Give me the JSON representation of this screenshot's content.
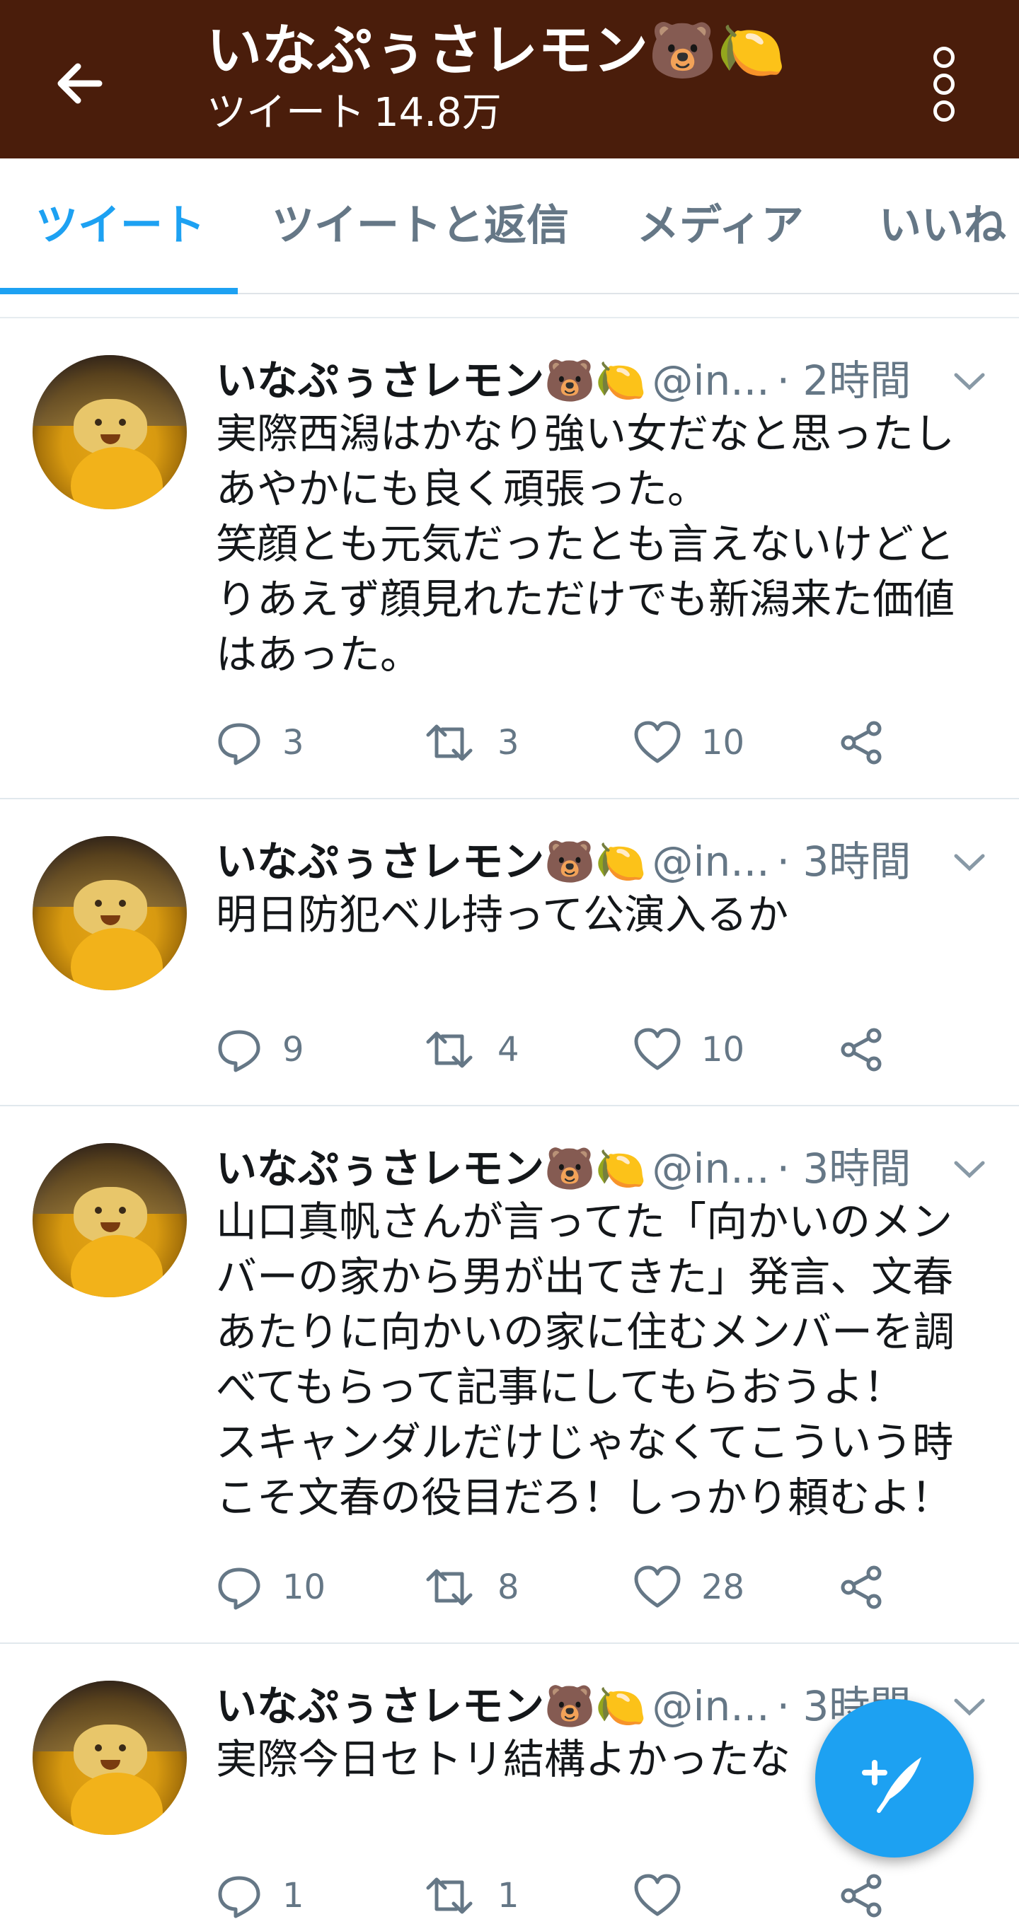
{
  "header": {
    "back_icon": "arrow-left-icon",
    "profile_name": "いなぷぅさレモン🐻🍋",
    "tweet_label": "ツイート",
    "tweet_count": "14.8万",
    "more_icon": "vertical-dots-icon",
    "background_color": "#4a1d0b"
  },
  "tabs": [
    {
      "label": "ツイート",
      "active": true
    },
    {
      "label": "ツイートと返信",
      "active": false
    },
    {
      "label": "メディア",
      "active": false
    },
    {
      "label": "いいね",
      "active": false
    }
  ],
  "accent_color": "#1da1f2",
  "tweets": [
    {
      "name": "いなぷぅさレモン🐻🍋",
      "handle": "@in...",
      "time": "· 2時間",
      "text": "実際西潟はかなり強い女だなと思ったし\nあやかにも良く頑張った。\n笑顔とも元気だったとも言えないけどと\nりあえず顔見れただけでも新潟来た価値\nはあった。",
      "replies": "3",
      "retweets": "3",
      "likes": "10"
    },
    {
      "name": "いなぷぅさレモン🐻🍋",
      "handle": "@in...",
      "time": "· 3時間",
      "text": "明日防犯ベル持って公演入るか",
      "replies": "9",
      "retweets": "4",
      "likes": "10"
    },
    {
      "name": "いなぷぅさレモン🐻🍋",
      "handle": "@in...",
      "time": "· 3時間",
      "text": "山口真帆さんが言ってた「向かいのメン\nバーの家から男が出てきた」発言、文春\nあたりに向かいの家に住むメンバーを調\nべてもらって記事にしてもらおうよ！\nスキャンダルだけじゃなくてこういう時\nこそ文春の役目だろ！しっかり頼むよ！",
      "replies": "10",
      "retweets": "8",
      "likes": "28"
    },
    {
      "name": "いなぷぅさレモン🐻🍋",
      "handle": "@in...",
      "time": "· 3時間",
      "text": "実際今日セトリ結構よかったな",
      "replies": "1",
      "retweets": "1",
      "likes": ""
    }
  ],
  "fab": {
    "icon": "compose-tweet-icon"
  }
}
